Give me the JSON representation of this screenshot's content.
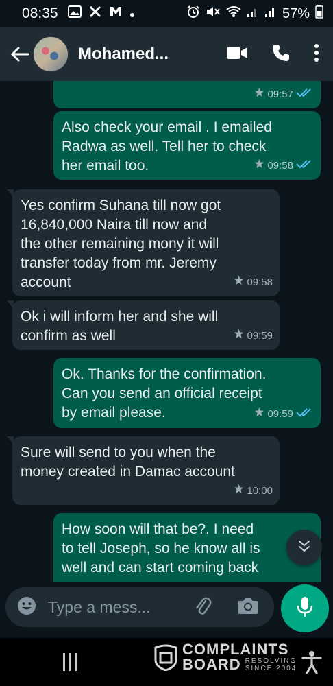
{
  "status_bar": {
    "time": "08:35",
    "battery": "57%"
  },
  "header": {
    "contact_name": "Mohamed...",
    "icons": [
      "back-arrow-icon",
      "video-call-icon",
      "voice-call-icon",
      "more-options-icon"
    ]
  },
  "messages": [
    {
      "direction": "out",
      "text": "",
      "time": "09:57",
      "status": "read"
    },
    {
      "direction": "out",
      "text": "Also check your email . I emailed\nRadwa as well. Tell her to check\nher email too.",
      "time": "09:58",
      "status": "read"
    },
    {
      "direction": "in",
      "text": "Yes confirm Suhana till now got\n16,840,000 Naira till now and\nthe other remaining mony it will\ntransfer today from mr. Jeremy\naccount",
      "time": "09:58"
    },
    {
      "direction": "in",
      "text": "Ok i will inform her and she will\nconfirm as well",
      "time": "09:59"
    },
    {
      "direction": "out",
      "text": "Ok. Thanks for the confirmation.\nCan you send an official receipt\nby email please.",
      "time": "09:59",
      "status": "read"
    },
    {
      "direction": "in",
      "text": "Sure will send to you when the\nmoney created in Damac account",
      "time": "10:00"
    },
    {
      "direction": "out",
      "text": "How soon will that be?. I need\nto tell Joseph, so he know all is\nwell and can start coming back",
      "time": "",
      "status": ""
    }
  ],
  "composer": {
    "placeholder": "Type a mess..."
  },
  "watermark": {
    "line1": "COMPLAINTS",
    "line2": "BOARD",
    "tagline1": "RESOLVING",
    "tagline2": "SINCE 2004"
  },
  "colors": {
    "background": "#0b141a",
    "header": "#1f2c34",
    "outgoing_bubble": "#005c4b",
    "incoming_bubble": "#1f2c34",
    "read_ticks": "#53bdeb",
    "accent": "#00a884"
  }
}
